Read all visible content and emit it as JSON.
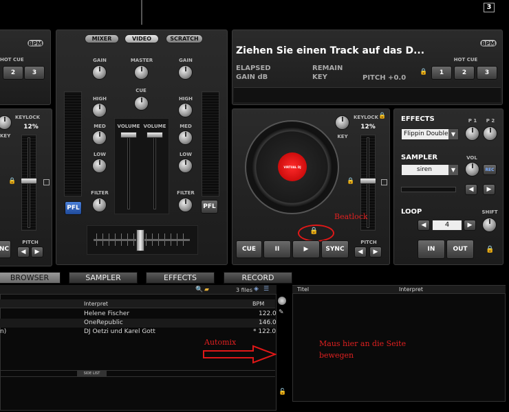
{
  "top": {
    "counter": "3"
  },
  "left_deck": {
    "bpm": "BPM",
    "hot_cue": "HOT CUE",
    "hot_cue_buttons": [
      "2",
      "3"
    ],
    "keylock": "KEYLOCK",
    "key": "KEY",
    "percent": "12%",
    "pitch": "PITCH",
    "sync_fragment": "NC"
  },
  "mixer": {
    "tabs": [
      "MIXER",
      "VIDEO",
      "SCRATCH"
    ],
    "gain": "GAIN",
    "master": "MASTER",
    "cue": "CUE",
    "high": "HIGH",
    "med": "MED",
    "low": "LOW",
    "volume": "VOLUME",
    "filter": "FILTER",
    "pfl": "PFL"
  },
  "right_deck": {
    "title": "Ziehen Sie einen Track auf das D...",
    "bpm": "BPM",
    "elapsed": "ELAPSED",
    "remain": "REMAIN",
    "gain_db": "GAIN dB",
    "key": "KEY",
    "pitch_value": "PITCH +0.0",
    "hot_cue": "HOT CUE",
    "hot_cue_buttons": [
      "1",
      "2",
      "3"
    ],
    "keylock": "KEYLOCK",
    "percent": "12%",
    "key_knob": "KEY",
    "platter_logo": "VIRTUAL DJ",
    "pitch": "PITCH",
    "transport": {
      "cue": "CUE",
      "pause": "II",
      "play": "▶",
      "sync": "SYNC"
    }
  },
  "effects": {
    "title": "EFFECTS",
    "p1": "P 1",
    "p2": "P 2",
    "effect_value": "Flippin Double",
    "sampler": "SAMPLER",
    "vol": "VOL",
    "rec": "REC",
    "sampler_value": "siren",
    "loop": "LOOP",
    "shift": "SHIFT",
    "loop_value": "4",
    "in": "IN",
    "out": "OUT"
  },
  "browser": {
    "tabs": [
      "BROWSER",
      "SAMPLER",
      "EFFECTS",
      "RECORD"
    ],
    "files": "3 files",
    "col_interpret": "Interpret",
    "col_bpm": "BPM",
    "rows": [
      {
        "interpret": "Helene Fischer",
        "bpm": "122.0"
      },
      {
        "interpret": "OneRepublic",
        "bpm": "146.0"
      },
      {
        "prefix": "n)",
        "interpret": "DJ Oetzi und Karel Gott",
        "bpm": "* 122.0"
      }
    ],
    "side_list": "SIDE LIST",
    "right_col_titel": "Titel",
    "right_col_interpret": "Interpret"
  },
  "annotations": {
    "beatlock": "Beatlock",
    "automix": "Automix",
    "maus": "Maus hier an die Seite bewegen"
  }
}
